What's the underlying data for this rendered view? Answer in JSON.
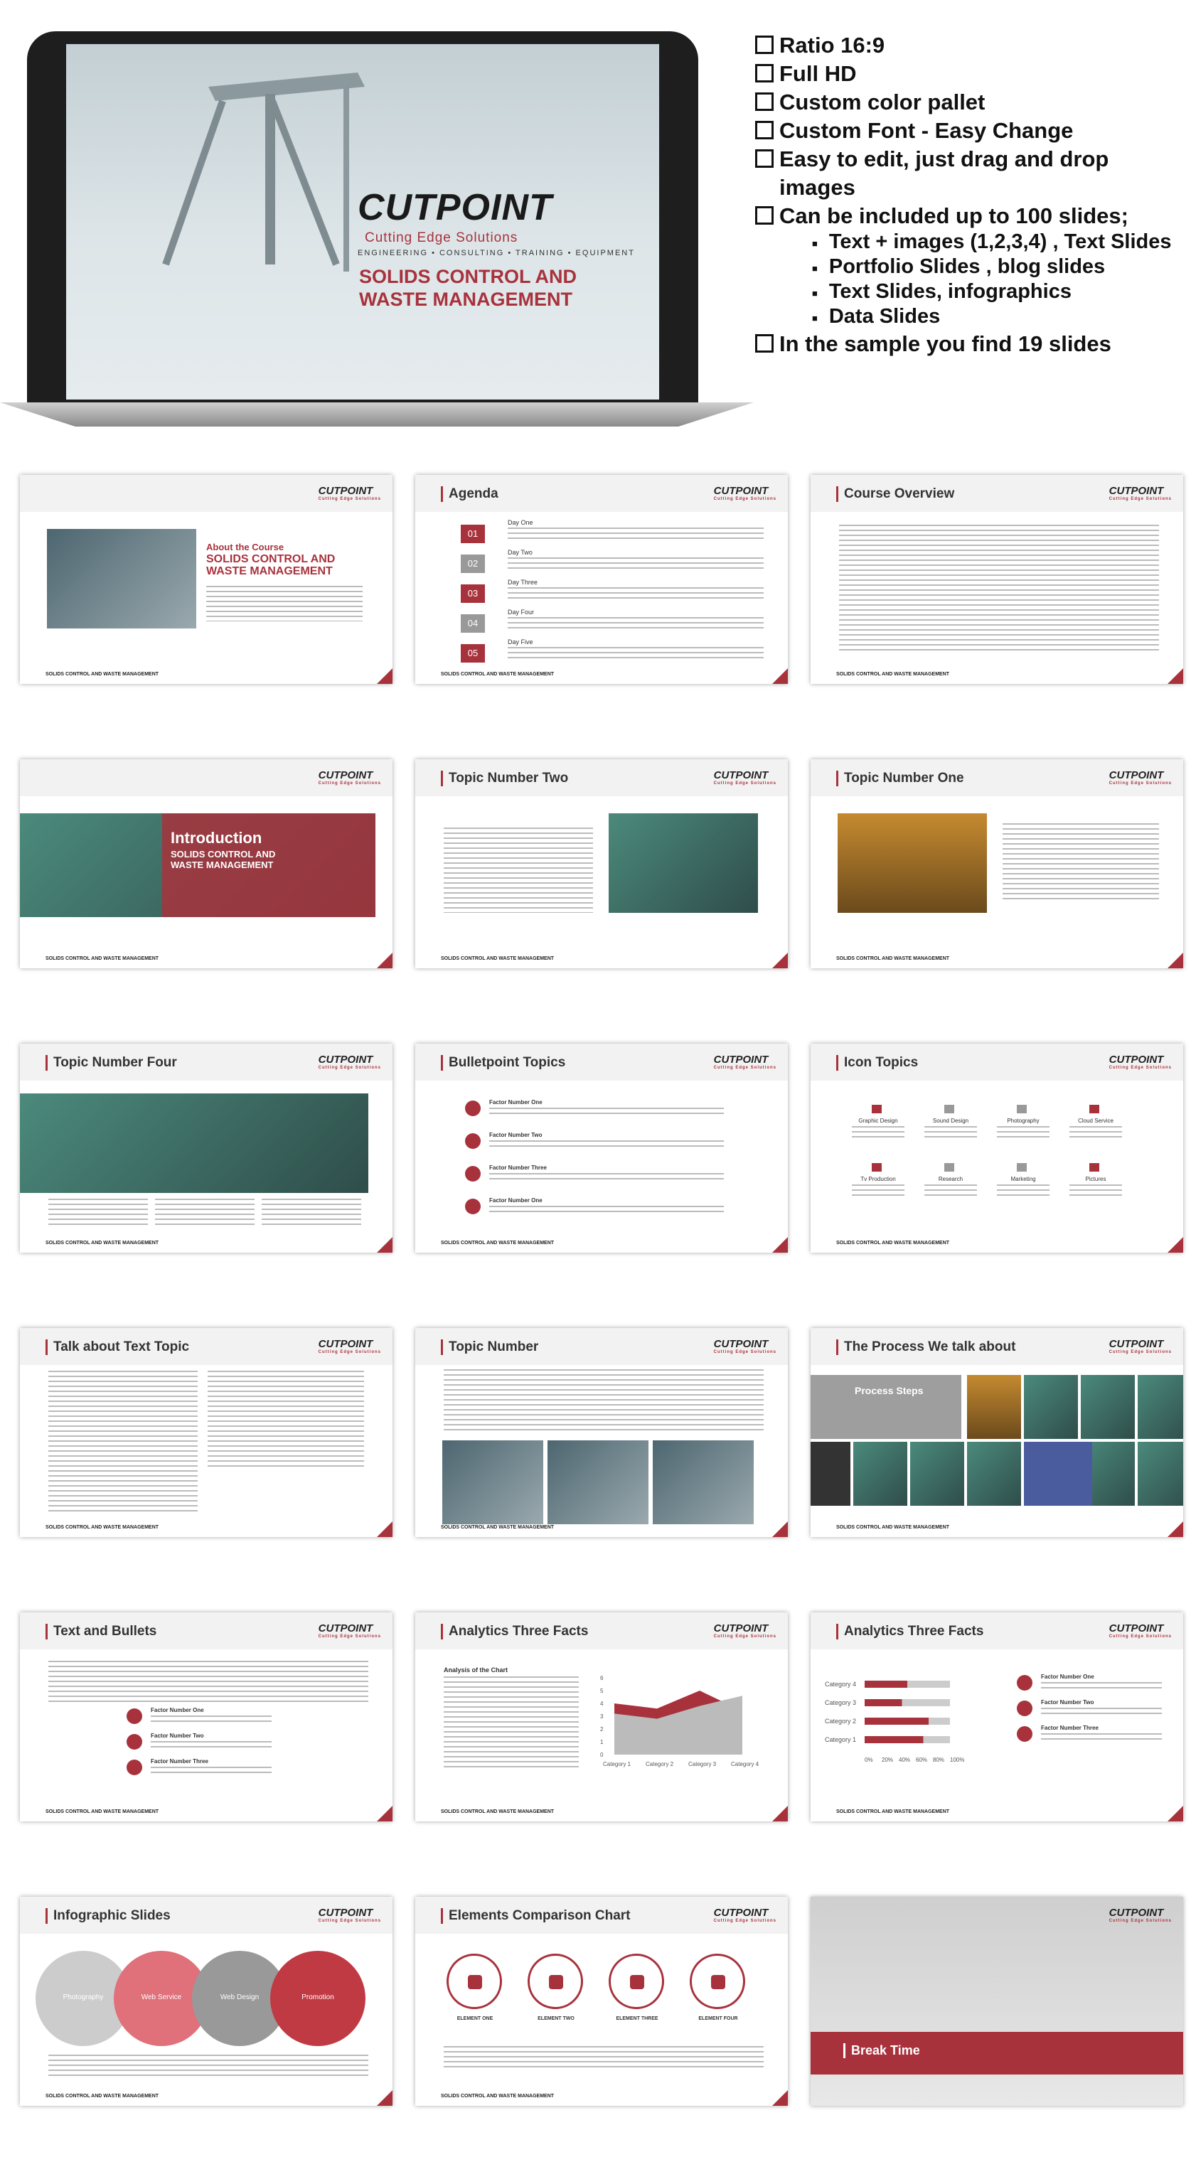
{
  "hero": {
    "logo": "CUTPOINT",
    "tagline": "Cutting Edge Solutions",
    "services": "ENGINEERING • CONSULTING • TRAINING • EQUIPMENT",
    "title_line1": "SOLIDS CONTROL AND",
    "title_line2": "WASTE MANAGEMENT"
  },
  "features": {
    "items": [
      "Ratio 16:9",
      "Full HD",
      "Custom color pallet",
      "Custom Font -  Easy Change",
      "Easy to edit, just drag and drop images",
      "Can be included up to 100 slides;"
    ],
    "sub": [
      "Text + images (1,2,3,4) , Text Slides",
      "Portfolio Slides , blog slides",
      "Text Slides, infographics",
      "Data Slides"
    ],
    "last": "In the sample you find 19 slides"
  },
  "common": {
    "logo": "CUTPOINT",
    "tagline": "Cutting Edge Solutions",
    "footer": "SOLIDS CONTROL AND WASTE MANAGEMENT"
  },
  "slides": [
    {
      "title": "",
      "head": "About the Course",
      "head2": "SOLIDS CONTROL AND WASTE MANAGEMENT"
    },
    {
      "title": "Agenda",
      "rows": [
        {
          "n": "01",
          "d": "Day One"
        },
        {
          "n": "02",
          "d": "Day Two"
        },
        {
          "n": "03",
          "d": "Day Three"
        },
        {
          "n": "04",
          "d": "Day Four"
        },
        {
          "n": "05",
          "d": "Day Five"
        }
      ]
    },
    {
      "title": "Course Overview"
    },
    {
      "title": "",
      "head": "Introduction",
      "head2": "SOLIDS CONTROL AND WASTE MANAGEMENT"
    },
    {
      "title": "Topic Number Two"
    },
    {
      "title": "Topic Number One"
    },
    {
      "title": "Topic Number Four"
    },
    {
      "title": "Bulletpoint Topics",
      "items": [
        "Factor Number One",
        "Factor Number Two",
        "Factor Number Three",
        "Factor Number One"
      ]
    },
    {
      "title": "Icon Topics",
      "items": [
        "Graphic Design",
        "Sound Design",
        "Photography",
        "Cloud Service",
        "Tv Production",
        "Research",
        "Marketing",
        "Pictures"
      ]
    },
    {
      "title": "Talk about Text  Topic"
    },
    {
      "title": "Topic Number"
    },
    {
      "title": "The Process We talk about",
      "head": "Process Steps"
    },
    {
      "title": "Text and Bullets",
      "items": [
        "Factor Number One",
        "Factor Number Two",
        "Factor Number Three"
      ]
    },
    {
      "title": "Analytics Three Facts",
      "head": "Analysis of the Chart"
    },
    {
      "title": "Analytics Three Facts",
      "items": [
        "Factor Number One",
        "Factor Number Two",
        "Factor Number Three"
      ]
    },
    {
      "title": "Infographic Slides",
      "items": [
        "Photography",
        "Web Service",
        "Web Design",
        "Promotion"
      ]
    },
    {
      "title": "Elements Comparison Chart",
      "items": [
        "ELEMENT ONE",
        "ELEMENT TWO",
        "ELEMENT THREE",
        "ELEMENT FOUR"
      ]
    },
    {
      "title": "",
      "head": "Break Time"
    }
  ],
  "chart_data": [
    {
      "type": "area",
      "categories": [
        "Category 1",
        "Category 2",
        "Category 3",
        "Category 4"
      ],
      "series": [
        {
          "values": [
            4,
            3.6,
            5,
            3.4
          ]
        },
        {
          "values": [
            3.2,
            2.8,
            3.8,
            4.6
          ]
        }
      ],
      "ylim": [
        0,
        6
      ],
      "yticks": [
        0,
        1,
        2,
        3,
        4,
        5,
        6
      ]
    },
    {
      "type": "bar",
      "categories": [
        "Category 4",
        "Category 3",
        "Category 2",
        "Category 1"
      ],
      "series": [
        {
          "values": [
            40,
            35,
            60,
            55
          ]
        },
        {
          "values": [
            80,
            80,
            80,
            80
          ]
        }
      ],
      "xlim": [
        0,
        100
      ],
      "xticks": [
        "0%",
        "20%",
        "40%",
        "60%",
        "80%",
        "100%"
      ]
    }
  ]
}
